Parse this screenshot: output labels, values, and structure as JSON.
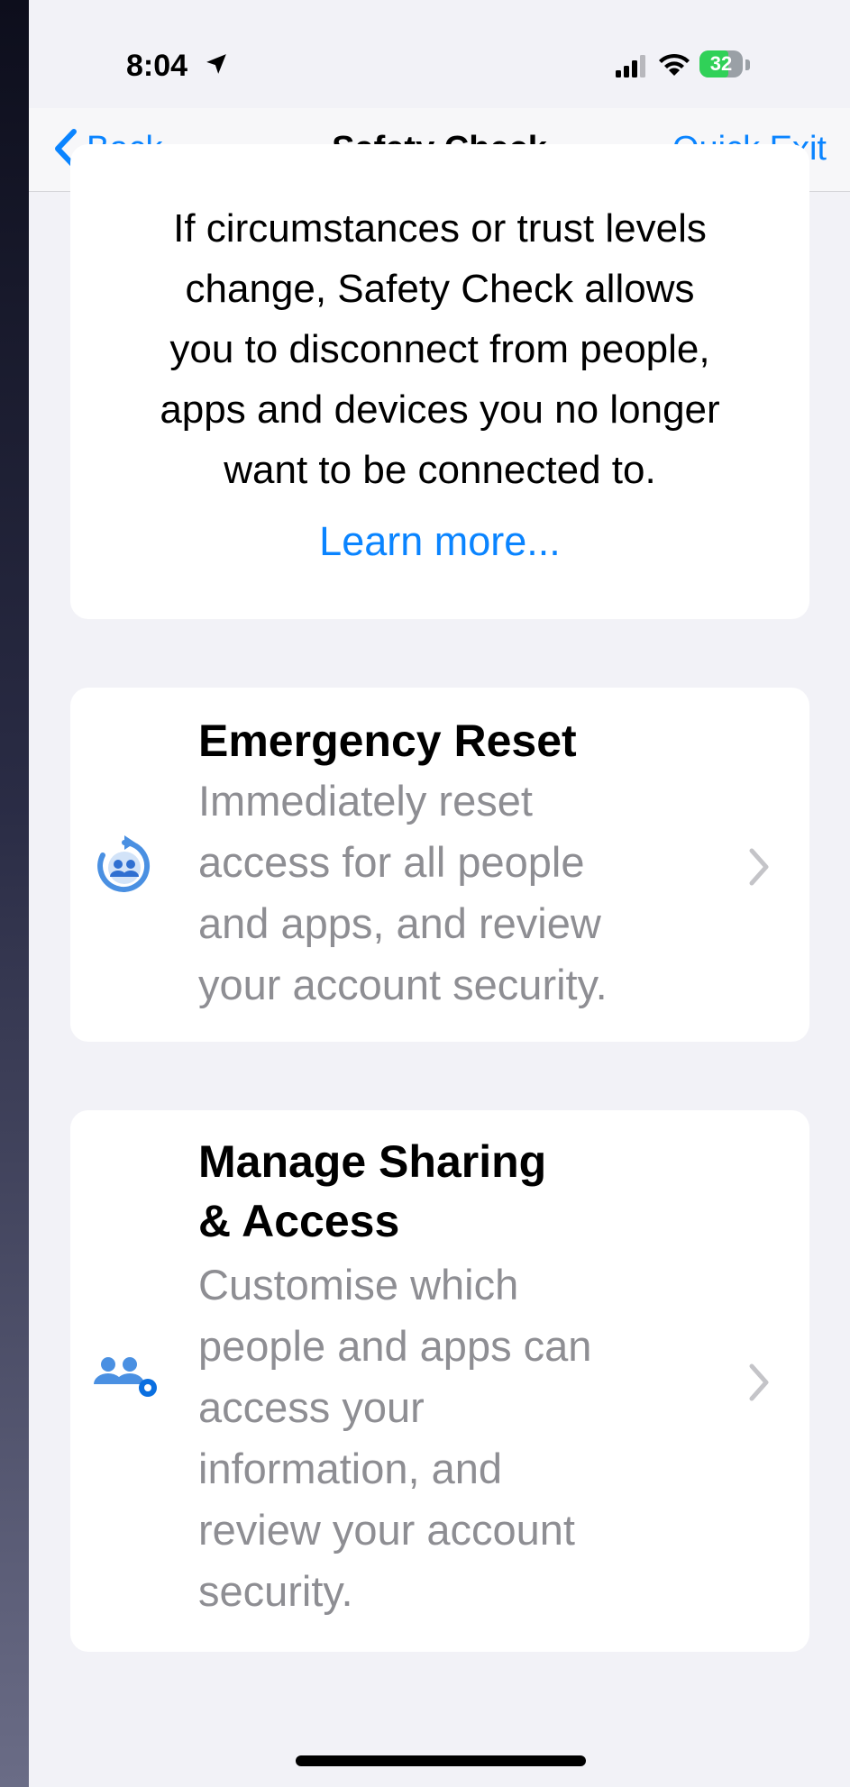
{
  "status_bar": {
    "time": "8:04",
    "battery_level": "32",
    "icons": [
      "location-arrow-icon",
      "signal-icon",
      "wifi-icon",
      "battery-icon"
    ]
  },
  "nav": {
    "back_label": "Back",
    "title": "Safety Check",
    "quick_exit_label": "Quick Exit"
  },
  "intro": {
    "lines": [
      "If circumstances or trust levels",
      "change, Safety Check allows",
      "you to disconnect from people,",
      "apps and devices you no longer",
      "want to be connected to."
    ],
    "learn_more": "Learn more..."
  },
  "emergency_reset": {
    "title": "Emergency Reset",
    "description_lines": [
      "Immediately reset",
      "access for all people",
      "and apps, and review",
      "your account security."
    ],
    "icon": "person-reset-icon"
  },
  "manage_sharing": {
    "title_lines": [
      "Manage Sharing",
      "& Access"
    ],
    "description_lines": [
      "Customise which",
      "people and apps can",
      "access your",
      "information, and",
      "review your account",
      "security."
    ],
    "icon": "people-gear-icon"
  },
  "colors": {
    "accent": "#0a84ff",
    "icon_blue": "#4a90e2",
    "secondary_text": "#8e8e93",
    "background": "#f2f2f7"
  }
}
